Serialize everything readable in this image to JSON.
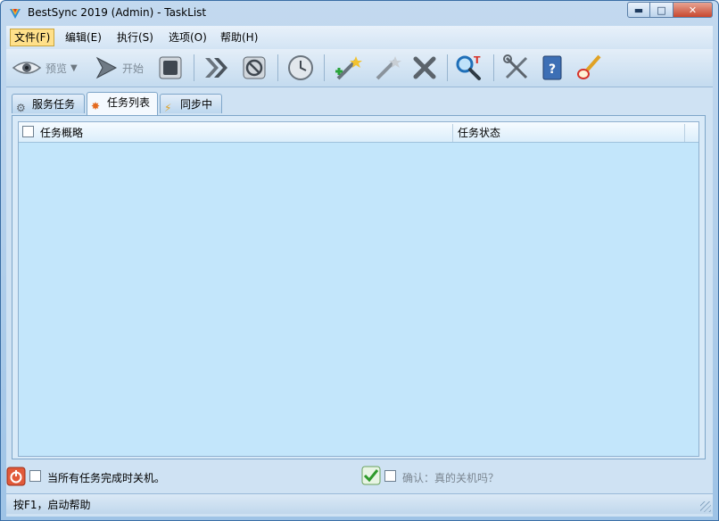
{
  "window": {
    "title": "BestSync 2019 (Admin) - TaskList"
  },
  "menu": [
    "文件(F)",
    "编辑(E)",
    "执行(S)",
    "选项(O)",
    "帮助(H)"
  ],
  "toolbar": {
    "preview_label": "预览",
    "start_label": "开始"
  },
  "tabs": [
    "服务任务",
    "任务列表",
    "同步中"
  ],
  "list": {
    "columns": [
      "任务概略",
      "任务状态"
    ]
  },
  "options": {
    "shutdown_label": "当所有任务完成时关机。",
    "confirm_label": "确认：真的关机吗？"
  },
  "status": {
    "text": "按F1，启动帮助"
  },
  "colors": {
    "list_background": "#c3e6fb",
    "active_menu": "#ffe08a"
  }
}
